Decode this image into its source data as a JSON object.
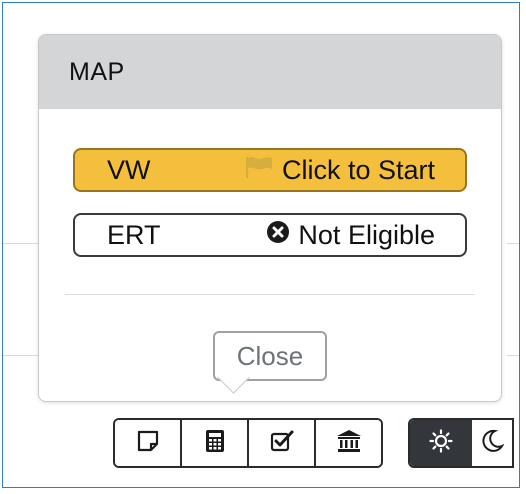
{
  "popover": {
    "title": "MAP",
    "items": [
      {
        "code": "VW",
        "status": "Click to Start",
        "icon": "flag-icon"
      },
      {
        "code": "ERT",
        "status": "Not Eligible",
        "icon": "x-circle-icon"
      }
    ],
    "close_label": "Close"
  },
  "toolbar": {
    "icons": [
      "note-icon",
      "calculator-icon",
      "checklist-icon",
      "bank-icon"
    ]
  },
  "theme_toggle": {
    "icons": [
      "sun-icon",
      "moon-icon"
    ],
    "active": "sun-icon"
  },
  "colors": {
    "accent": "#f5bf3e",
    "header_bg": "#d3d5d6",
    "frame_border": "#2a7fc9"
  }
}
